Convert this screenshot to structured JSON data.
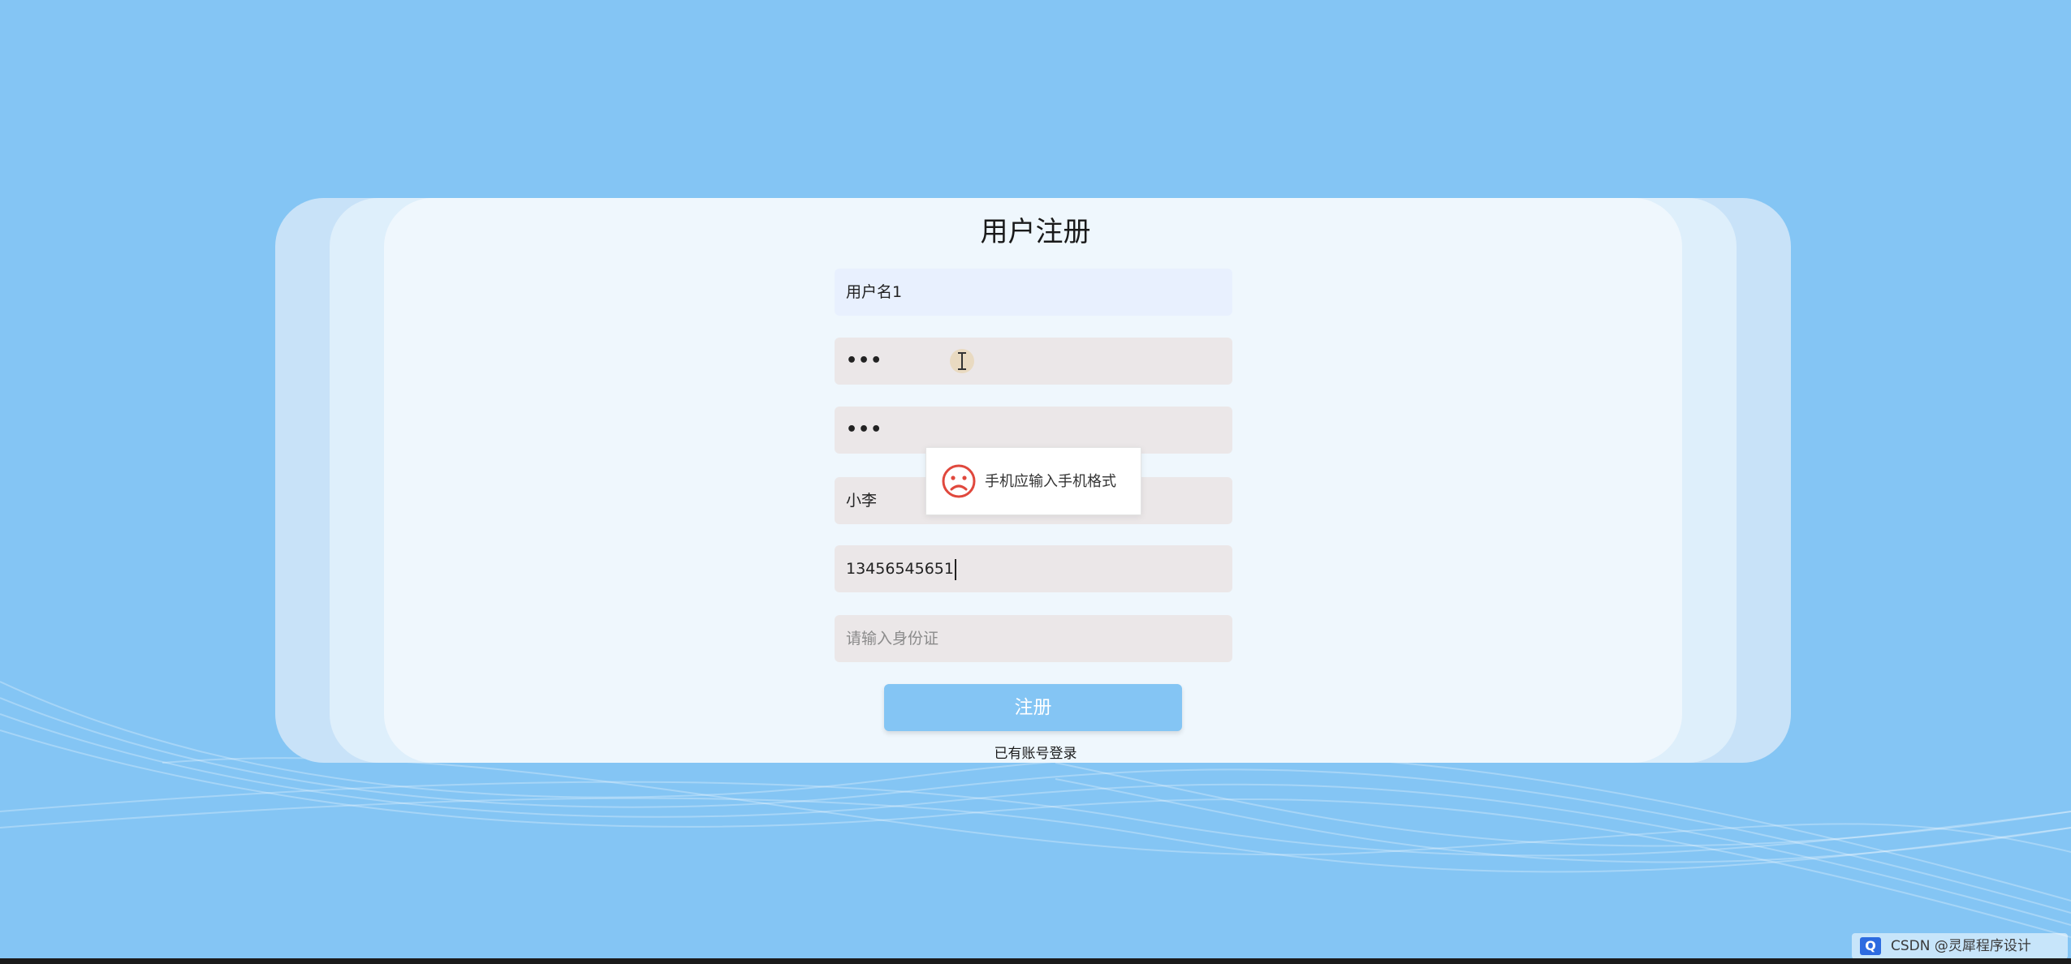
{
  "page": {
    "title": "用户注册",
    "background_color": "#84c5f4"
  },
  "form": {
    "username_value": "用户名1",
    "password_value": "•••",
    "confirm_password_value": "•••",
    "nickname_value": "小李",
    "phone_value": "13456545651",
    "id_card_placeholder": "请输入身份证",
    "submit_label": "注册",
    "login_link_label": "已有账号登录"
  },
  "toast": {
    "icon": "sad-face-icon",
    "message": "手机应输入手机格式",
    "color": "#e0483d"
  },
  "watermark": {
    "text": "CSDN @灵犀程序设计"
  },
  "colors": {
    "field_bg": "#ebe7e8",
    "autofill_bg": "#e8f0fe",
    "card_bg": "#eff7fd",
    "button_bg": "#84c5f4"
  }
}
